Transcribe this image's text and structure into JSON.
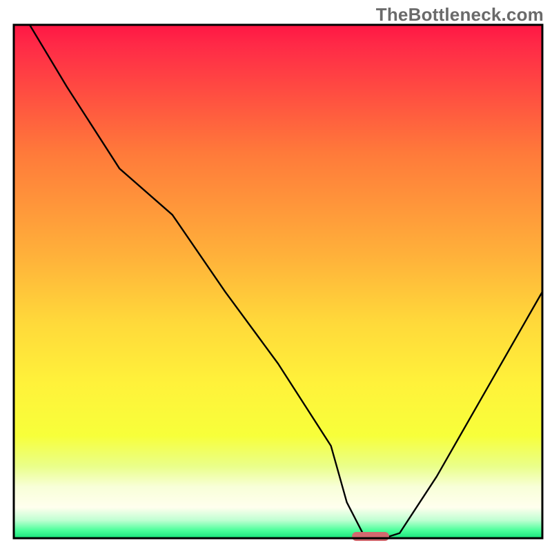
{
  "watermark": {
    "text": "TheBottleneck.com"
  },
  "chart_data": {
    "type": "line",
    "title": "",
    "xlabel": "",
    "ylabel": "",
    "xlim": [
      0,
      100
    ],
    "ylim": [
      0,
      100
    ],
    "x": [
      3,
      10,
      20,
      30,
      40,
      50,
      60,
      63,
      66,
      70,
      73,
      80,
      90,
      100
    ],
    "values": [
      100,
      88,
      72,
      63,
      48,
      34,
      18,
      7,
      1,
      0,
      1,
      12,
      30,
      48
    ],
    "series_name": "bottleneck-curve",
    "marker": {
      "x_range": [
        64,
        71
      ],
      "y": 0,
      "color": "#d2696f"
    },
    "background_gradient": {
      "stops": [
        {
          "offset": 0.0,
          "color": "#ff1744"
        },
        {
          "offset": 0.04,
          "color": "#ff2a47"
        },
        {
          "offset": 0.25,
          "color": "#ff7a3a"
        },
        {
          "offset": 0.45,
          "color": "#ffb13a"
        },
        {
          "offset": 0.58,
          "color": "#ffd93a"
        },
        {
          "offset": 0.7,
          "color": "#fff23a"
        },
        {
          "offset": 0.8,
          "color": "#f7ff3a"
        },
        {
          "offset": 0.86,
          "color": "#eaff8a"
        },
        {
          "offset": 0.9,
          "color": "#f8ffd8"
        },
        {
          "offset": 0.94,
          "color": "#ffffee"
        },
        {
          "offset": 0.965,
          "color": "#bfffd2"
        },
        {
          "offset": 0.985,
          "color": "#4aff9a"
        },
        {
          "offset": 1.0,
          "color": "#18e27a"
        }
      ]
    },
    "frame_color": "#000000",
    "curve_color": "#000000"
  }
}
